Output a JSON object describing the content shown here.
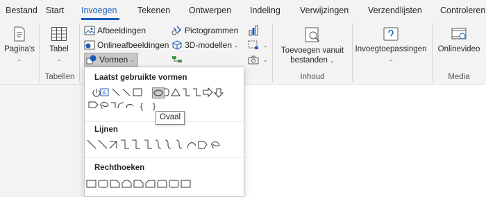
{
  "tabs": [
    "Bestand",
    "Start",
    "Invoegen",
    "Tekenen",
    "Ontwerpen",
    "Indeling",
    "Verwijzingen",
    "Verzendlijsten",
    "Controleren"
  ],
  "active_tab": "Invoegen",
  "ribbon": {
    "pages_label": "Pagina's",
    "table_label": "Tabel",
    "tables_group": "Tabellen",
    "images_label": "Afbeeldingen",
    "online_images_label": "Onlineafbeeldingen",
    "shapes_label": "Vormen",
    "pictograms_label": "Pictogrammen",
    "models_3d_label": "3D-modellen",
    "add_from_files_line1": "Toevoegen vanuit",
    "add_from_files_line2": "bestanden",
    "content_group": "Inhoud",
    "addins_label": "Invoegtoepassingen",
    "online_video_label": "Onlinevideo",
    "media_group": "Media"
  },
  "shapes_panel": {
    "recent_title": "Laatst gebruikte vormen",
    "lines_title": "Lijnen",
    "rectangles_title": "Rechthoeken",
    "selected_shape": "Ovaal"
  },
  "tooltip": "Ovaal",
  "colors": {
    "accent": "#185abd",
    "ribbon_bg": "#f3f3f3",
    "selected_bg": "#c8c8c8"
  }
}
